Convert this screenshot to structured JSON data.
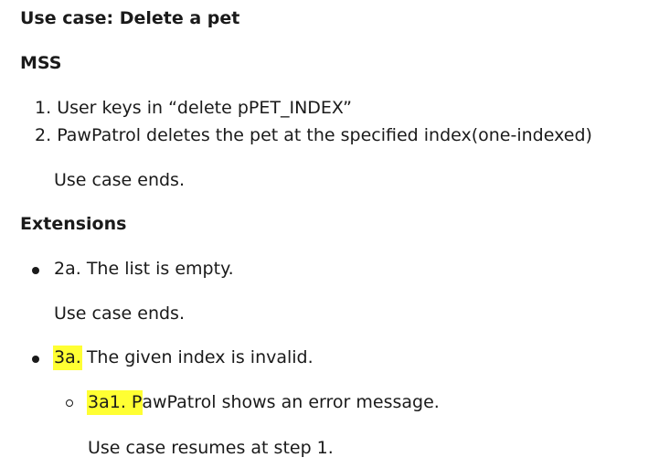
{
  "doc": {
    "title": "Use case: Delete a pet",
    "mss_heading": "MSS",
    "mss_steps": [
      {
        "num": "1.",
        "text": "User keys in “delete pPET_INDEX”"
      },
      {
        "num": "2.",
        "text": "PawPatrol deletes the pet at the specified index(one-indexed)"
      }
    ],
    "mss_end": "Use case ends.",
    "extensions_heading": "Extensions",
    "extensions": [
      {
        "label": "2a.",
        "text": " The list is empty.",
        "end": "Use case ends."
      },
      {
        "label": "3a.",
        "text": " The given index is invalid.",
        "sub": {
          "label_highlighted": "3a1. P",
          "text": "awPatrol shows an error message.",
          "end": "Use case resumes at step 1."
        }
      }
    ]
  },
  "colors": {
    "highlight": "#ffff33",
    "text": "#1a1a1a"
  }
}
